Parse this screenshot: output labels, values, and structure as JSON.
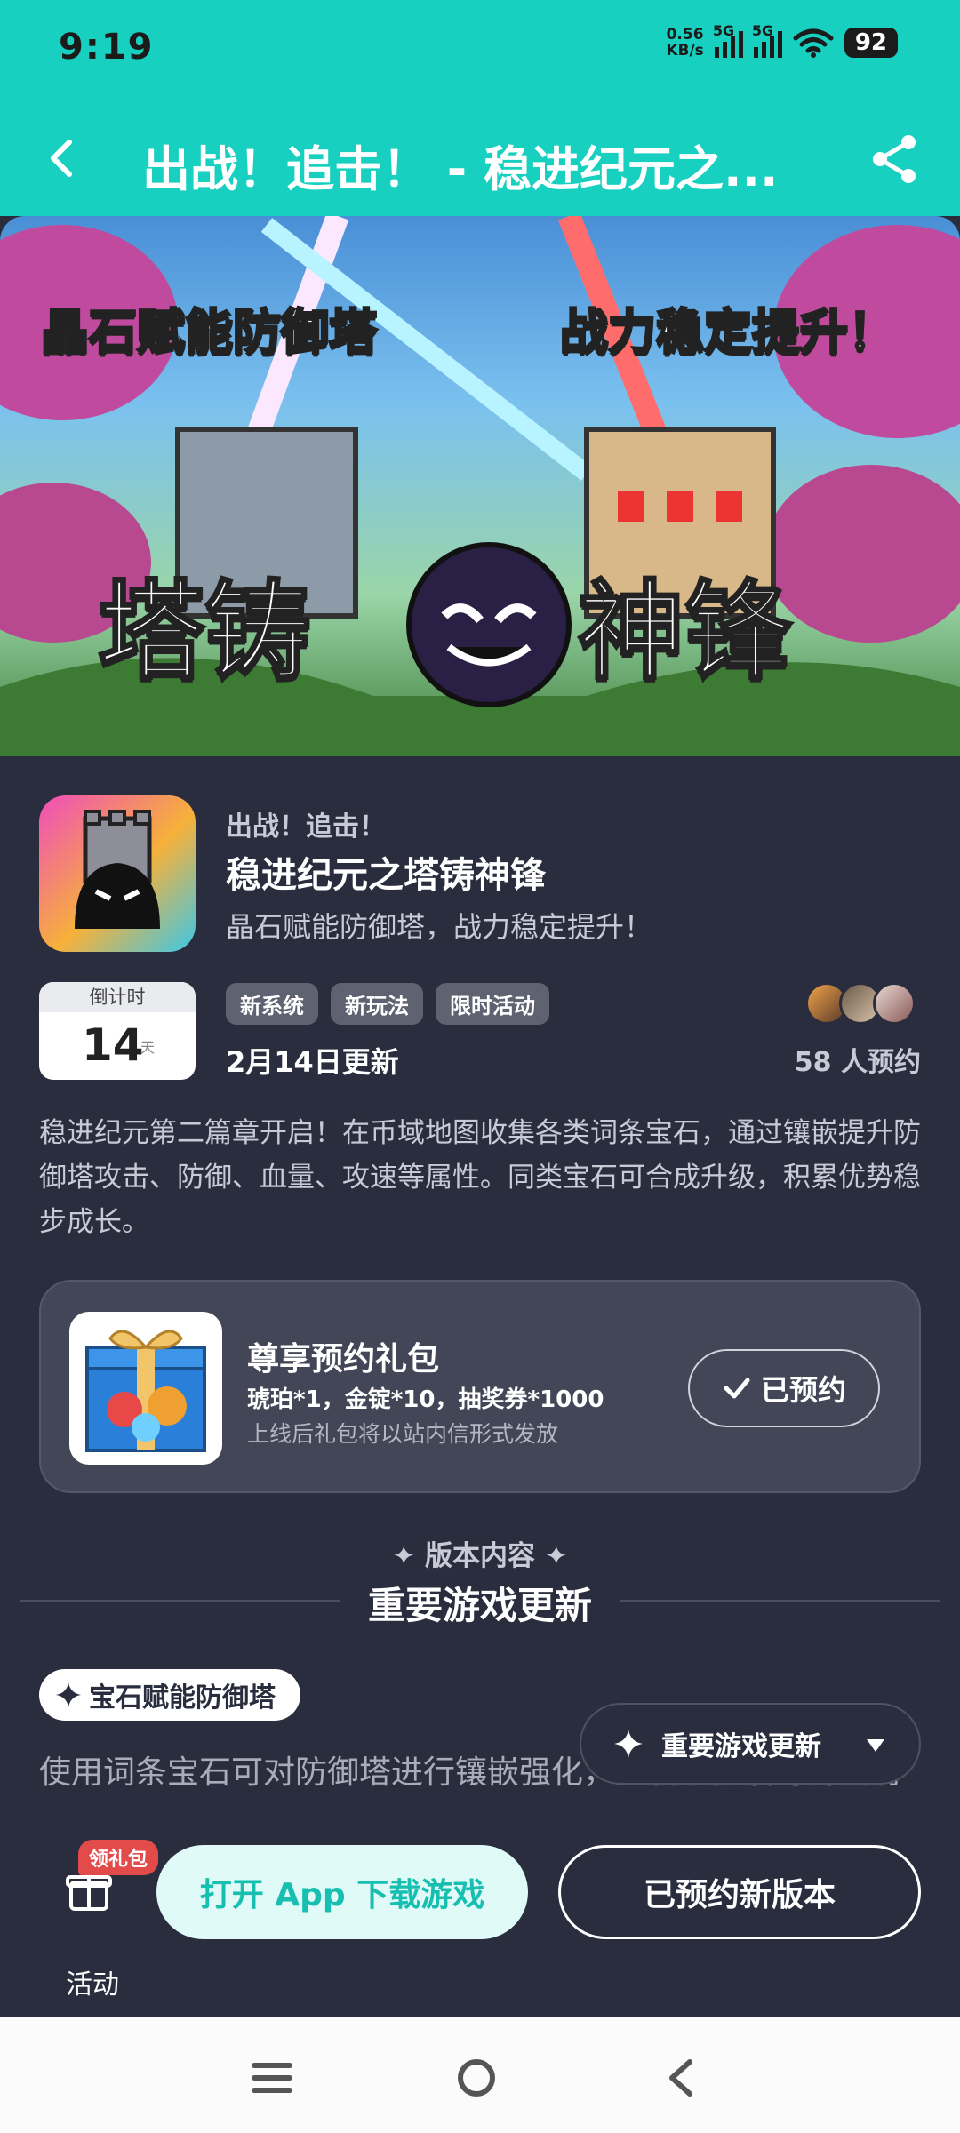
{
  "status_bar": {
    "time": "9:19",
    "net_speed_value": "0.56",
    "net_speed_unit": "KB/s",
    "sim1_label": "5G",
    "sim2_label": "5G",
    "battery": "92"
  },
  "header": {
    "title": "出战！追击！ - 稳进纪元之..."
  },
  "banner": {
    "line1": "晶石赋能防御塔",
    "line2": "战力稳定提升！",
    "logo_left": "塔铸",
    "logo_right": "神锋"
  },
  "app": {
    "kicker": "出战！追击！",
    "name": "稳进纪元之塔铸神锋",
    "subtitle": "晶石赋能防御塔，战力稳定提升！"
  },
  "countdown": {
    "label": "倒计时",
    "value": "14",
    "unit": "天"
  },
  "tags": [
    "新系统",
    "新玩法",
    "限时活动"
  ],
  "update_date": "2月14日更新",
  "reserve_count": "58 人预约",
  "description": "稳进纪元第二篇章开启！在币域地图收集各类词条宝石，通过镶嵌提升防御塔攻击、防御、血量、攻速等属性。同类宝石可合成升级，积累优势稳步成长。",
  "gift": {
    "title": "尊享预约礼包",
    "items": "琥珀*1，金锭*10，抽奖券*1000",
    "note": "上线后礼包将以站内信形式发放",
    "button_label": "已预约"
  },
  "version": {
    "kicker": "✦ 版本内容 ✦",
    "title": "重要游戏更新"
  },
  "section": {
    "chip_label": "宝石赋能防御塔",
    "text": "使用词条宝石可对防御塔进行镶嵌强化，宝石镶嵌后可对所有防御塔，可提升防御塔基础属性；专属类宝石仅限对应塔"
  },
  "float_dropdown": {
    "label": "重要游戏更新"
  },
  "bottom_bar": {
    "badge": "领礼包",
    "activity_label": "活动",
    "open_app_label": "打开 App 下载游戏",
    "reserved_label": "已预约新版本"
  },
  "colors": {
    "accent": "#17d0c0",
    "background": "#2a2d3d",
    "card": "#434656",
    "badge_red": "#e34b4b"
  }
}
